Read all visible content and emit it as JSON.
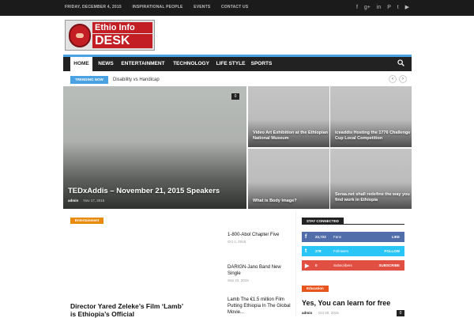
{
  "topbar": {
    "date": "FRIDAY, DECEMBER 4, 2015",
    "links": [
      "INSPIRATIONAL PEOPLE",
      "EVENTS",
      "CONTACT US"
    ],
    "social_icons": [
      "facebook-icon",
      "google-plus-icon",
      "linkedin-icon",
      "pinterest-icon",
      "twitter-icon",
      "youtube-icon"
    ]
  },
  "logo": {
    "line1": "Ethio Info",
    "line2": "DESK",
    "color": "#c21e24"
  },
  "nav": {
    "items": [
      "HOME",
      "NEWS",
      "ENTERTAINMENT",
      "TECHNOLOGY",
      "LIFE STYLE",
      "SPORTS"
    ],
    "accent": "#4aa2e2"
  },
  "trending": {
    "badge": "TRENDING NOW",
    "text": "Disability vs Handicap"
  },
  "featured": {
    "main": {
      "title": "TEDxAddis – November 21, 2015 Speakers",
      "author": "admin",
      "date": "Nov 17, 2015",
      "comments": "0"
    },
    "tiles": [
      {
        "title": "Video Art Exhibition at the Ethiopian National Museum"
      },
      {
        "title": "iceaddis Hosting the 1776 Challenge Cup Local Competition"
      },
      {
        "title": "What is Body Image?"
      },
      {
        "title": "Seraa.net shall redefine the way you find work in Ethiopia"
      }
    ]
  },
  "entertainment": {
    "category": "Entertainment",
    "main_title": "Director Yared Zeleke’s Film ‘Lamb’ is Ethiopia’s Official",
    "list": [
      {
        "title": "1-800-Abol Chapter Five",
        "date": "Oct 1, 2015"
      },
      {
        "title": "DARIGN-Jano Band New Single",
        "date": "Sep 23, 2015"
      },
      {
        "title": "Lamb The €1.5 million Film Putting Ethiopia In The Global Movie...",
        "date": ""
      }
    ]
  },
  "sidebar": {
    "stay_connected": "STAY CONNECTED",
    "social": [
      {
        "count": "22,722",
        "label": "Fans",
        "action": "LIKE",
        "color": "#516eab"
      },
      {
        "count": "278",
        "label": "Followers",
        "action": "FOLLOW",
        "color": "#29c5f6"
      },
      {
        "count": "0",
        "label": "Subscribers",
        "action": "SUBSCRIBE",
        "color": "#e14e42"
      }
    ],
    "education": {
      "category": "Education",
      "title": "Yes, You can learn for free",
      "author": "admin",
      "date": "Oct 20, 2015",
      "comments": "0"
    }
  }
}
